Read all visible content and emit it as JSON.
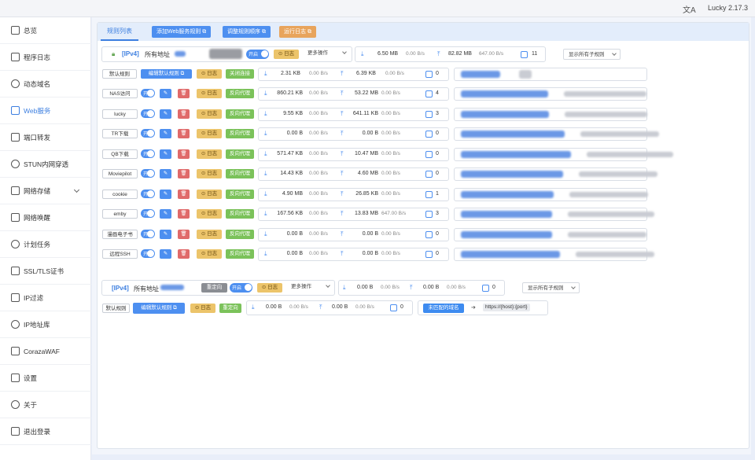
{
  "app": {
    "title": "Lucky 2.17.3",
    "lang_icon": "translate-icon"
  },
  "sidebar": {
    "items": [
      {
        "label": "总览",
        "icon": "dashboard-icon"
      },
      {
        "label": "程序日志",
        "icon": "log-icon"
      },
      {
        "label": "动态域名",
        "icon": "globe-icon"
      },
      {
        "label": "Web服务",
        "icon": "web-icon",
        "active": true
      },
      {
        "label": "端口转发",
        "icon": "port-icon"
      },
      {
        "label": "STUN内网穿透",
        "icon": "stun-icon"
      },
      {
        "label": "网络存储",
        "icon": "cloud-icon"
      },
      {
        "label": "网络唤醒",
        "icon": "bell-icon"
      },
      {
        "label": "计划任务",
        "icon": "clock-icon"
      },
      {
        "label": "SSL/TLS证书",
        "icon": "cert-icon"
      },
      {
        "label": "IP过滤",
        "icon": "ip-filter-icon"
      },
      {
        "label": "IP地址库",
        "icon": "ip-db-icon"
      },
      {
        "label": "CorazaWAF",
        "icon": "shield-icon"
      },
      {
        "label": "设置",
        "icon": "gear-icon"
      },
      {
        "label": "关于",
        "icon": "about-icon"
      },
      {
        "label": "退出登录",
        "icon": "logout-icon"
      }
    ]
  },
  "tabs": {
    "active": "规则列表",
    "add": "添加Web服务规则",
    "sort": "调整规则顺序",
    "runlog": "运行日志"
  },
  "ruleset1": {
    "proto": "[IPv4]",
    "addr": "所有地址",
    "toggle": "开启",
    "log": "日志",
    "more": "更多操作",
    "down": "6.50 MB",
    "down_rate": "0.00 B/s",
    "up": "82.82 MB",
    "up_rate": "647.00 B/s",
    "conn": "11",
    "filter": "显示所有子规则",
    "default_label": "默认规则",
    "edit_default": "编辑默认规则",
    "def_log": "日志",
    "def_close": "关闭连接",
    "def_down": "2.31 KB",
    "def_down_rate": "0.00 B/s",
    "def_up": "6.39 KB",
    "def_up_rate": "0.00 B/s",
    "def_conn": "0"
  },
  "rules": [
    {
      "name": "NAS访问",
      "toggle": "开",
      "log": "日志",
      "type": "反向代理",
      "down": "860.21 KB",
      "down_rate": "0.00 B/s",
      "up": "53.22 MB",
      "up_rate": "0.00 B/s",
      "conn": "4"
    },
    {
      "name": "lucky",
      "toggle": "开",
      "log": "日志",
      "type": "反向代理",
      "down": "9.55 KB",
      "down_rate": "0.00 B/s",
      "up": "641.11 KB",
      "up_rate": "0.00 B/s",
      "conn": "3"
    },
    {
      "name": "TR下载",
      "toggle": "开",
      "log": "日志",
      "type": "反向代理",
      "down": "0.00 B",
      "down_rate": "0.00 B/s",
      "up": "0.00 B",
      "up_rate": "0.00 B/s",
      "conn": "0"
    },
    {
      "name": "QB下载",
      "toggle": "开",
      "log": "日志",
      "type": "反向代理",
      "down": "571.47 KB",
      "down_rate": "0.00 B/s",
      "up": "10.47 MB",
      "up_rate": "0.00 B/s",
      "conn": "0"
    },
    {
      "name": "Moviepilot",
      "toggle": "开",
      "log": "日志",
      "type": "反向代理",
      "down": "14.43 KB",
      "down_rate": "0.00 B/s",
      "up": "4.60 MB",
      "up_rate": "0.00 B/s",
      "conn": "0"
    },
    {
      "name": "cookie",
      "toggle": "开",
      "log": "日志",
      "type": "反向代理",
      "down": "4.90 MB",
      "down_rate": "0.00 B/s",
      "up": "26.85 KB",
      "up_rate": "0.00 B/s",
      "conn": "1"
    },
    {
      "name": "emby",
      "toggle": "开",
      "log": "日志",
      "type": "反向代理",
      "down": "167.56 KB",
      "down_rate": "0.00 B/s",
      "up": "13.83 MB",
      "up_rate": "647.00 B/s",
      "conn": "3"
    },
    {
      "name": "漫画电子书",
      "toggle": "开",
      "log": "日志",
      "type": "反向代理",
      "down": "0.00 B",
      "down_rate": "0.00 B/s",
      "up": "0.00 B",
      "up_rate": "0.00 B/s",
      "conn": "0"
    },
    {
      "name": "远程SSH",
      "toggle": "开",
      "log": "日志",
      "type": "反向代理",
      "down": "0.00 B",
      "down_rate": "0.00 B/s",
      "up": "0.00 B",
      "up_rate": "0.00 B/s",
      "conn": "0"
    }
  ],
  "ruleset2": {
    "proto": "[IPv4]",
    "addr": "所有地址",
    "redirect": "重定向",
    "toggle": "开启",
    "log": "日志",
    "more": "更多操作",
    "down": "0.00 B",
    "down_rate": "0.00 B/s",
    "up": "0.00 B",
    "up_rate": "0.00 B/s",
    "conn": "0",
    "filter": "显示所有子规则",
    "default_label": "默认规则",
    "edit_default": "编辑默认规则",
    "def_log": "日志",
    "def_redirect": "重定向",
    "def_down": "0.00 B",
    "def_down_rate": "0.00 B/s",
    "def_up": "0.00 B",
    "def_up_rate": "0.00 B/s",
    "def_conn": "0",
    "unmatched": "未匹配的域名",
    "target": "https://{host}:{port}"
  }
}
